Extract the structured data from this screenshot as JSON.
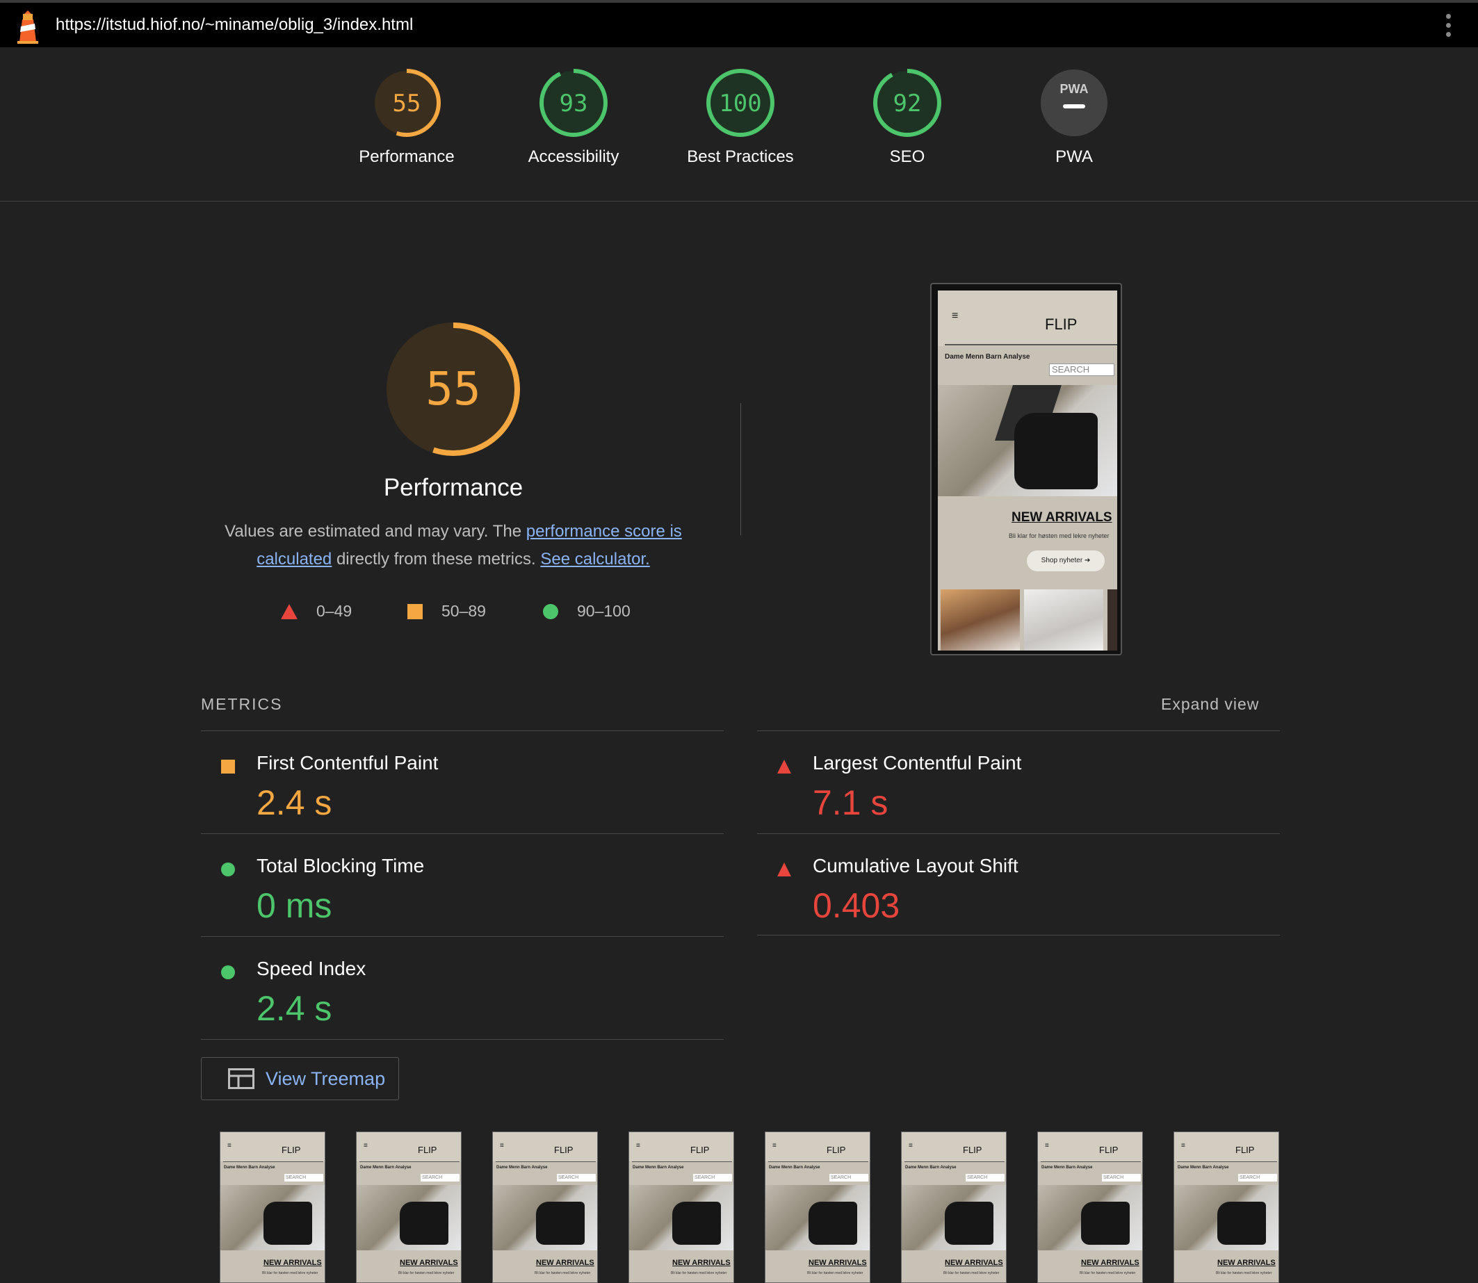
{
  "browser": {
    "url": "https://itstud.hiof.no/~miname/oblig_3/index.html",
    "logo_icon": "lighthouse-icon",
    "menu_icon": "more-vert-icon"
  },
  "scores": [
    {
      "label": "Performance",
      "value": "55",
      "score": 55,
      "color": "#f5a742",
      "bg": "#3a2e1e"
    },
    {
      "label": "Accessibility",
      "value": "93",
      "score": 93,
      "color": "#4cc56b",
      "bg": "#1e3324"
    },
    {
      "label": "Best Practices",
      "value": "100",
      "score": 100,
      "color": "#4cc56b",
      "bg": "#1e3324"
    },
    {
      "label": "SEO",
      "value": "92",
      "score": 92,
      "color": "#4cc56b",
      "bg": "#1e3324"
    },
    {
      "label": "PWA",
      "value": "PWA",
      "color": "#ffffff",
      "bg": "#424242"
    }
  ],
  "performance": {
    "score": "55",
    "score_fraction": 0.55,
    "title": "Performance",
    "desc_pre": "Values are estimated and may vary. The ",
    "desc_link1": "performance score is calculated",
    "desc_mid": " directly from these metrics. ",
    "desc_link2": "See calculator."
  },
  "legend": [
    {
      "shape": "triangle",
      "range": "0–49",
      "color": "#e8453c"
    },
    {
      "shape": "square",
      "range": "50–89",
      "color": "#f5a742"
    },
    {
      "shape": "circle",
      "range": "90–100",
      "color": "#4cc56b"
    }
  ],
  "final_screenshot": {
    "menu": "≡",
    "logo": "FLIP",
    "nav": "Dame  Menn  Barn  Analyse",
    "search": "SEARCH",
    "heading": "NEW ARRIVALS",
    "subtext": "Bli klar for høsten med lekre nyheter",
    "button": "Shop nyheter ➔"
  },
  "metrics": {
    "header": "METRICS",
    "expand": "Expand view",
    "items": [
      {
        "name": "First Contentful Paint",
        "value": "2.4 s",
        "rating": "average",
        "color": "#f5a742"
      },
      {
        "name": "Largest Contentful Paint",
        "value": "7.1 s",
        "rating": "fail",
        "color": "#e8453c"
      },
      {
        "name": "Total Blocking Time",
        "value": "0 ms",
        "rating": "pass",
        "color": "#4cc56b"
      },
      {
        "name": "Cumulative Layout Shift",
        "value": "0.403",
        "rating": "fail",
        "color": "#e8453c"
      },
      {
        "name": "Speed Index",
        "value": "2.4 s",
        "rating": "pass",
        "color": "#4cc56b"
      }
    ]
  },
  "treemap": {
    "label": "View Treemap",
    "icon": "treemap-icon"
  },
  "filmstrip": {
    "menu": "≡",
    "logo": "FLIP",
    "nav": "Dame Menn Barn Analyse",
    "search": "SEARCH",
    "heading": "NEW ARRIVALS",
    "subtext": "Bli klar for høsten med lekre nyheter"
  }
}
